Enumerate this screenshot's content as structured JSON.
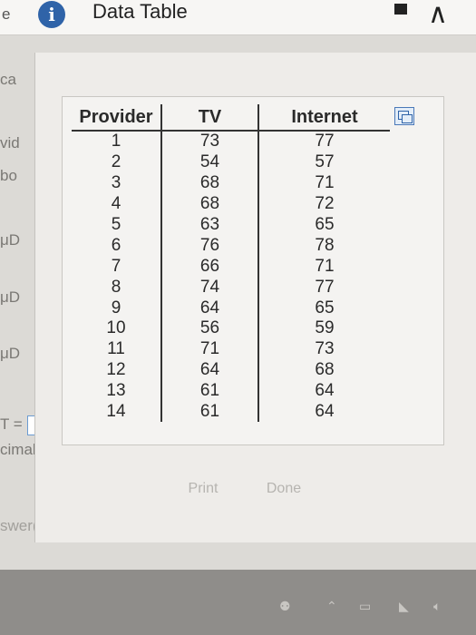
{
  "window": {
    "title": "Data Table",
    "info_icon": "i"
  },
  "background": {
    "fragments": [
      "e",
      "ca",
      "vid",
      "bo",
      "μD",
      "μD",
      "μD",
      "T =",
      "cimal",
      "swer(s).",
      "="
    ]
  },
  "table": {
    "headers": [
      "Provider",
      "TV",
      "Internet"
    ],
    "rows": [
      [
        "1",
        "73",
        "77"
      ],
      [
        "2",
        "54",
        "57"
      ],
      [
        "3",
        "68",
        "71"
      ],
      [
        "4",
        "68",
        "72"
      ],
      [
        "5",
        "63",
        "65"
      ],
      [
        "6",
        "76",
        "78"
      ],
      [
        "7",
        "66",
        "71"
      ],
      [
        "8",
        "74",
        "77"
      ],
      [
        "9",
        "64",
        "65"
      ],
      [
        "10",
        "56",
        "59"
      ],
      [
        "11",
        "71",
        "73"
      ],
      [
        "12",
        "64",
        "68"
      ],
      [
        "13",
        "61",
        "64"
      ],
      [
        "14",
        "61",
        "64"
      ]
    ]
  },
  "buttons": {
    "print": "Print",
    "done": "Done"
  },
  "icons": {
    "info": "info-icon",
    "copy": "copy-icon",
    "minimize": "minimize-icon",
    "collapse": "chevron-up-icon"
  },
  "colors": {
    "accent": "#2f63a8",
    "disabled_text": "#b6b4b0"
  }
}
